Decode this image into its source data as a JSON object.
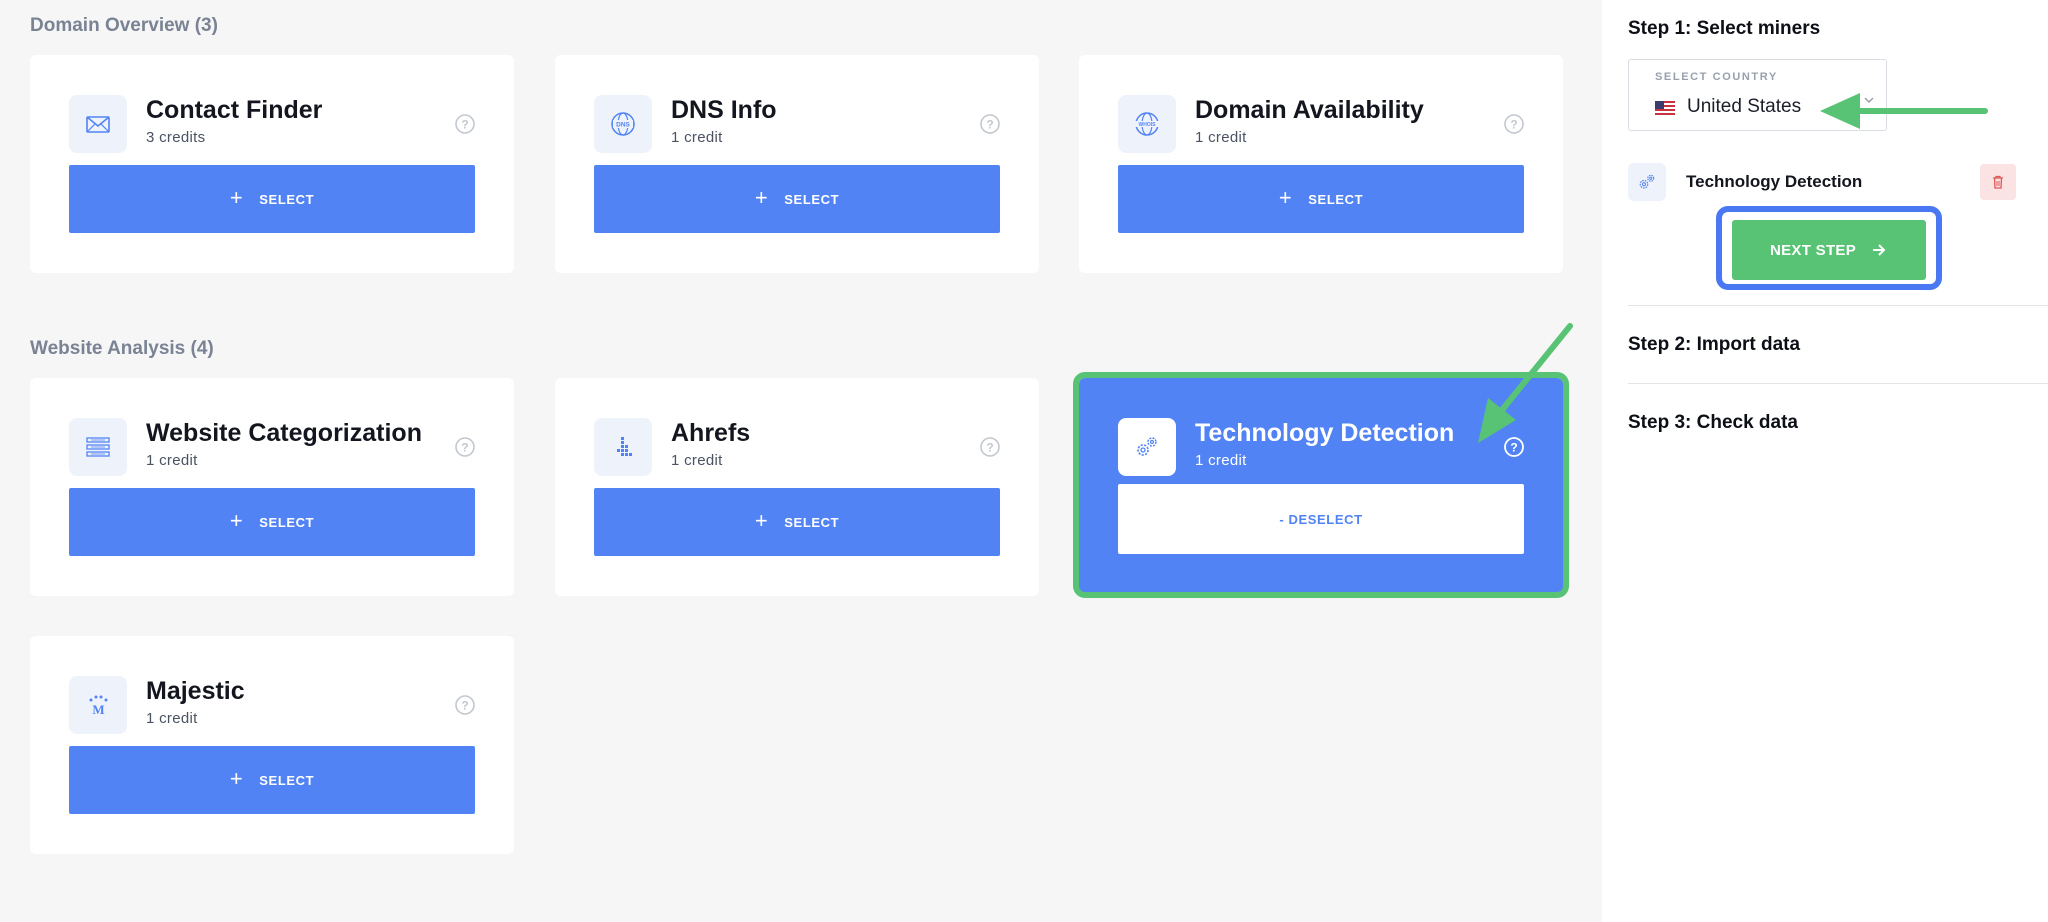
{
  "sections": {
    "domain_overview": "Domain Overview (3)",
    "website_analysis": "Website Analysis (4)"
  },
  "miners": [
    {
      "name": "Contact Finder",
      "credits": "3 credits",
      "icon": "envelope-icon",
      "action": "SELECT"
    },
    {
      "name": "DNS Info",
      "credits": "1 credit",
      "icon": "dns-globe-icon",
      "action": "SELECT"
    },
    {
      "name": "Domain Availability",
      "credits": "1 credit",
      "icon": "whois-globe-icon",
      "action": "SELECT"
    },
    {
      "name": "Website Categorization",
      "credits": "1 credit",
      "icon": "categories-list-icon",
      "action": "SELECT"
    },
    {
      "name": "Ahrefs",
      "credits": "1 credit",
      "icon": "ahrefs-logo-icon",
      "action": "SELECT"
    },
    {
      "name": "Technology Detection",
      "credits": "1 credit",
      "icon": "gears-icon",
      "action": "- DESELECT",
      "selected": true
    },
    {
      "name": "Majestic",
      "credits": "1 credit",
      "icon": "majestic-logo-icon",
      "action": "SELECT"
    }
  ],
  "sidebar": {
    "step1": "Step 1: Select miners",
    "country_label": "SELECT COUNTRY",
    "country_value": "United States",
    "selected_miner": "Technology Detection",
    "next_label": "NEXT STEP",
    "step2": "Step 2: Import data",
    "step3": "Step 3: Check data"
  },
  "colors": {
    "primary": "#5283f5",
    "success": "#58c374",
    "danger": "#e05656",
    "highlight_blue": "#4a78f2"
  }
}
